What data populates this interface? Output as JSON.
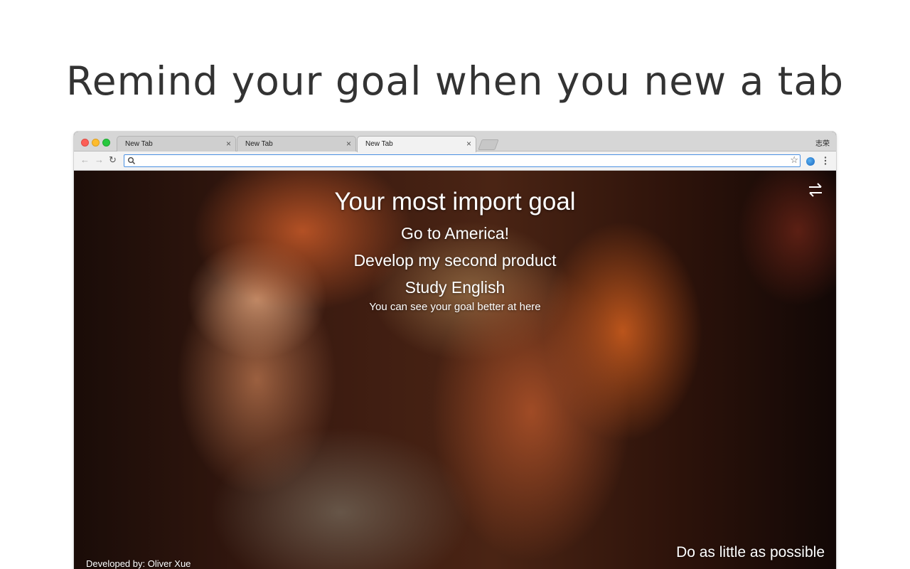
{
  "headline": "Remind your goal when you new a tab",
  "browser": {
    "tabs": [
      {
        "label": "New Tab",
        "active": false
      },
      {
        "label": "New Tab",
        "active": false
      },
      {
        "label": "New Tab",
        "active": true
      }
    ],
    "tab_close_glyph": "×",
    "profile_name": "志荣",
    "toolbar": {
      "back_icon": "←",
      "forward_icon": "→",
      "reload_icon": "↻",
      "address_value": "",
      "bookmark_icon": "☆"
    },
    "icons": [
      "back-arrow-icon",
      "forward-arrow-icon",
      "reload-icon",
      "search-icon",
      "bookmark-star-icon",
      "extension-icon",
      "menu-dots-icon",
      "swap-arrows-icon"
    ]
  },
  "content": {
    "heading": "Your most import goal",
    "goals": [
      "Go to America!",
      "Develop my second product",
      "Study English"
    ],
    "hint": "You can see your goal better at here",
    "motto": "Do as little as possible",
    "credit": "Developed by: Oliver Xue"
  },
  "colors": {
    "headline_text": "#333333",
    "omnibox_focus": "#4a90e2",
    "traffic_red": "#fc5f57",
    "traffic_yellow": "#fdbc2e",
    "traffic_green": "#28c840"
  }
}
